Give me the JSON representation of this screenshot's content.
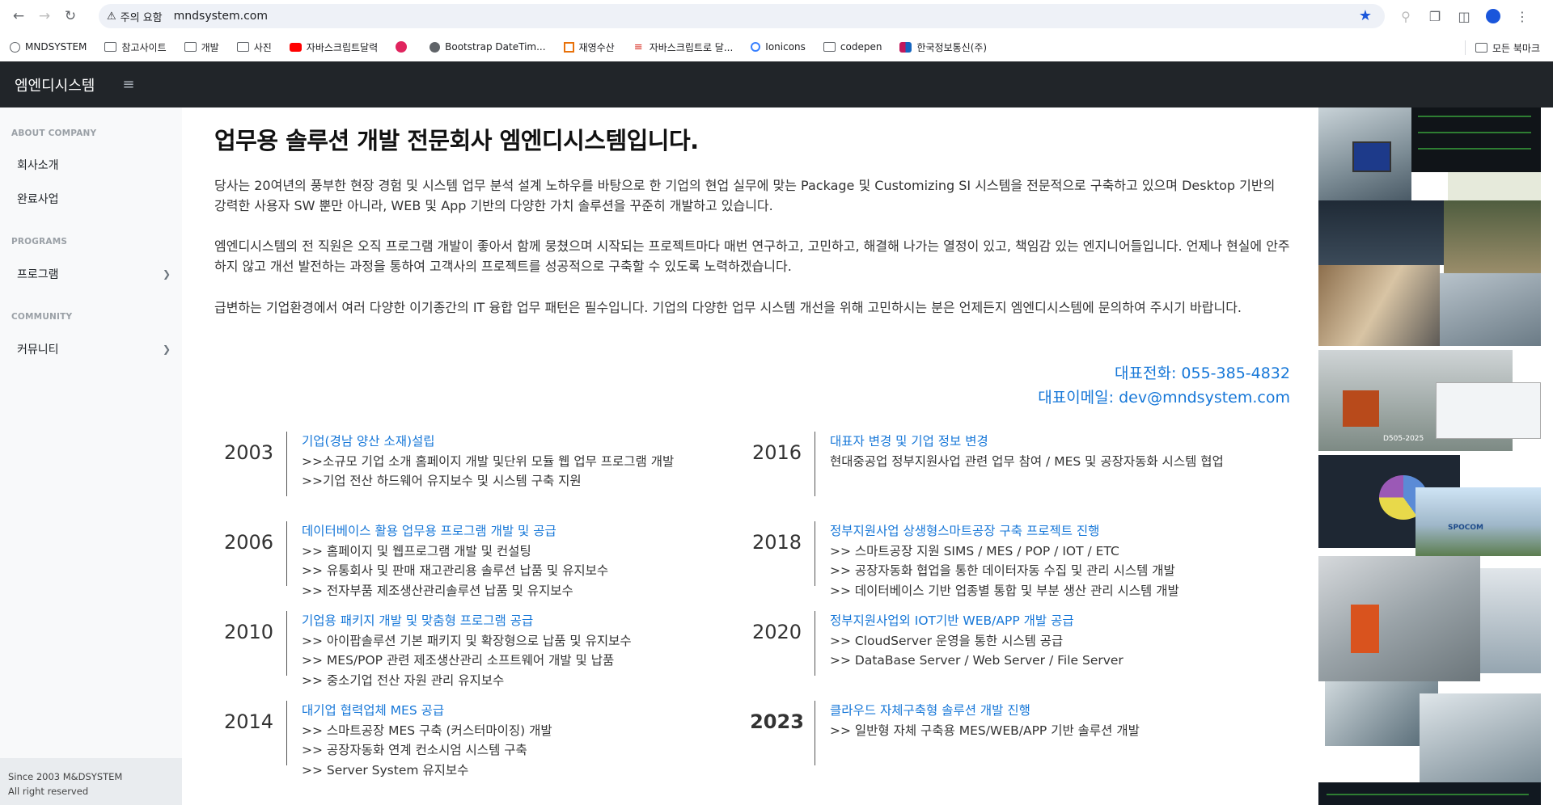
{
  "browser": {
    "security_label": "주의 요함",
    "url": "mndsystem.com",
    "bookmarks": [
      {
        "label": "MNDSYSTEM",
        "icon": "globe-icon"
      },
      {
        "label": "참고사이트",
        "icon": "folder-icon"
      },
      {
        "label": "개발",
        "icon": "folder-icon"
      },
      {
        "label": "사진",
        "icon": "folder-icon"
      },
      {
        "label": "자바스크립트달력",
        "icon": "youtube-icon"
      },
      {
        "label": "",
        "icon": "dribbble-icon"
      },
      {
        "label": "Bootstrap DateTim...",
        "icon": "globe-icon"
      },
      {
        "label": "재영수산",
        "icon": "site-icon"
      },
      {
        "label": "자바스크립트로 달...",
        "icon": "site-icon"
      },
      {
        "label": "Ionicons",
        "icon": "ionicons-icon"
      },
      {
        "label": "codepen",
        "icon": "folder-icon"
      },
      {
        "label": "한국정보통신(주)",
        "icon": "site-icon"
      }
    ],
    "all_bookmarks": "모든 북마크"
  },
  "header": {
    "brand": "엠엔디시스템"
  },
  "sidebar": {
    "sections": [
      {
        "heading": "ABOUT COMPANY",
        "items": [
          "회사소개",
          "완료사업"
        ]
      },
      {
        "heading": "PROGRAMS",
        "items": [
          "프로그램"
        ]
      },
      {
        "heading": "COMMUNITY",
        "items": [
          "커뮤니티"
        ]
      }
    ],
    "footer_line1": "Since 2003 M&DSYSTEM",
    "footer_line2": "All right reserved"
  },
  "main": {
    "title": "업무용 솔루션 개발 전문회사 엠엔디시스템입니다.",
    "paragraphs": [
      "당사는 20여년의 풍부한 현장 경험 및 시스템 업무 분석 설계 노하우를 바탕으로 한 기업의 현업 실무에 맞는 Package 및 Customizing SI 시스템을 전문적으로 구축하고 있으며 Desktop 기반의 강력한 사용자 SW 뿐만 아니라, WEB 및 App 기반의 다양한 가치 솔루션을 꾸준히 개발하고 있습니다.",
      "엠엔디시스템의 전 직원은 오직 프로그램 개발이 좋아서 함께 뭉쳤으며 시작되는 프로젝트마다 매번 연구하고, 고민하고, 해결해 나가는 열정이 있고, 책임감 있는 엔지니어들입니다. 언제나 현실에 안주하지 않고 개선 발전하는 과정을 통하여 고객사의 프로젝트를 성공적으로 구축할 수 있도록 노력하겠습니다.",
      "급변하는 기업환경에서 여러 다양한 이기종간의 IT 융합 업무 패턴은 필수입니다. 기업의 다양한 업무 시스템 개선을 위해 고민하시는 분은 언제든지 엠엔디시스템에 문의하여 주시기 바랍니다."
    ],
    "phone": "대표전화: 055-385-4832",
    "email": "대표이메일: dev@mndsystem.com",
    "timeline": [
      {
        "year": "2003",
        "head": "기업(경남 양산 소재)설립",
        "lines": [
          ">>소규모 기업 소개 홈페이지 개발 및단위 모듈 웹 업무 프로그램 개발",
          ">>기업 전산 하드웨어 유지보수 및 시스템 구축 지원"
        ]
      },
      {
        "year": "2016",
        "head": "대표자 변경 및 기업 정보 변경",
        "lines": [
          "현대중공업 정부지원사업 관련 업무 참여 / MES 및 공장자동화 시스템 협업"
        ]
      },
      {
        "year": "2006",
        "head": "데이터베이스 활용 업무용 프로그램 개발 및 공급",
        "lines": [
          ">> 홈페이지 및 웹프로그램 개발 및 컨설팅",
          ">> 유통회사 및 판매 재고관리용 솔루션 납품 및 유지보수",
          ">> 전자부품 제조생산관리솔루션 납품 및 유지보수"
        ]
      },
      {
        "year": "2018",
        "head": "정부지원사업 상생형스마트공장 구축 프로젝트 진행",
        "lines": [
          ">> 스마트공장 지원 SIMS / MES / POP / IOT / ETC",
          ">> 공장자동화 협업을 통한 데이터자동 수집 및 관리 시스템 개발",
          ">> 데이터베이스 기반 업종별 통합 및 부분 생산 관리 시스템 개발"
        ]
      },
      {
        "year": "2010",
        "head": "기업용 패키지 개발 및 맞춤형 프로그램 공급",
        "lines": [
          ">> 아이팝솔루션 기본 패키지 및 확장형으로 납품 및 유지보수",
          ">> MES/POP 관련 제조생산관리 소프트웨어 개발 및 납품",
          ">> 중소기업 전산 자원 관리 유지보수"
        ]
      },
      {
        "year": "2020",
        "head": "정부지원사업외 IOT기반 WEB/APP 개발 공급",
        "lines": [
          ">> CloudServer 운영을 통한 시스템 공급",
          ">> DataBase Server / Web Server / File Server"
        ]
      },
      {
        "year": "2014",
        "head": "대기업 협력업체 MES 공급",
        "lines": [
          ">> 스마트공장 MES 구축 (커스터마이징) 개발",
          ">> 공장자동화 연계 컨소시엄 시스템 구축",
          ">> Server System 유지보수"
        ]
      },
      {
        "year": "2023",
        "head": "클라우드 자체구축형 솔루션 개발 진행",
        "lines": [
          ">> 일반형 자체 구축용 MES/WEB/APP 기반 솔루션 개발"
        ]
      }
    ]
  },
  "photo_labels": [
    "D505-2025",
    "SPOCOM"
  ]
}
